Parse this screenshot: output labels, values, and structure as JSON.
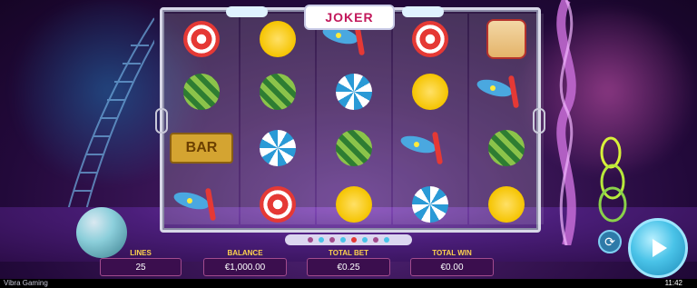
{
  "game": {
    "title": "JOKER",
    "provider": "Vibra Gaming",
    "time": "11:42"
  },
  "hud": {
    "lines": {
      "label": "LINES",
      "value": "25"
    },
    "balance": {
      "label": "BALANCE",
      "value": "€1,000.00"
    },
    "total_bet": {
      "label": "TOTAL BET",
      "value": "€0.25"
    },
    "total_win": {
      "label": "TOTAL WIN",
      "value": "€0.00"
    }
  },
  "reels": [
    [
      "red-candy",
      "green-candy",
      "bar-ticket",
      "juggling-pins"
    ],
    [
      "yellow-candy",
      "green-candy",
      "blue-candy",
      "red-candy"
    ],
    [
      "juggling-pins",
      "blue-candy",
      "green-candy",
      "yellow-candy"
    ],
    [
      "red-candy",
      "yellow-candy",
      "juggling-pins",
      "blue-candy"
    ],
    [
      "drum",
      "juggling-pins",
      "green-candy",
      "yellow-candy"
    ]
  ],
  "symbol_text": {
    "bar": "BAR"
  },
  "icons": {
    "spin": "play-triangle-icon",
    "autoplay": "refresh-icon"
  },
  "colors": {
    "accent": "#ffd34d",
    "hud_box": "#3b0e4e",
    "spin": "#4ac3e8"
  }
}
